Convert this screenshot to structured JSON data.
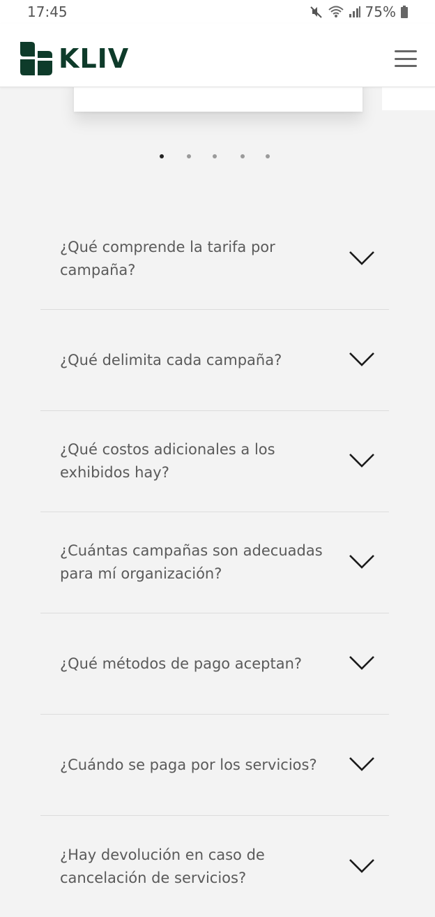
{
  "status_bar": {
    "time": "17:45",
    "battery": "75%",
    "icons": [
      "mute-icon",
      "wifi-icon",
      "signal-icon",
      "battery-icon"
    ]
  },
  "header": {
    "brand": "KLIV",
    "brand_color": "#0e3b2a",
    "menu_icon": "hamburger-menu-icon"
  },
  "carousel": {
    "dot_count": 5,
    "active_index": 0
  },
  "faq": {
    "items": [
      {
        "question": "¿Qué comprende la tarifa por campaña?"
      },
      {
        "question": "¿Qué delimita cada campaña?"
      },
      {
        "question": "¿Qué costos adicionales a los exhibidos hay?"
      },
      {
        "question": "¿Cuántas campañas son adecuadas para mí organización?"
      },
      {
        "question": "¿Qué métodos de pago aceptan?"
      },
      {
        "question": "¿Cuándo se paga por los servicios?"
      },
      {
        "question": "¿Hay devolución en caso de cancelación de servicios?"
      }
    ],
    "chevron_icon": "chevron-down-icon"
  }
}
